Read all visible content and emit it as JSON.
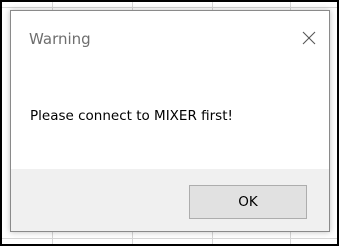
{
  "dialog": {
    "title": "Warning",
    "message": "Please connect to MIXER first!",
    "ok_label": "OK",
    "close_icon": "close-icon"
  },
  "colors": {
    "dialog_background": "#ffffff",
    "footer_background": "#f0f0f0",
    "button_background": "#e1e1e1",
    "button_border": "#adadad",
    "title_text": "#6e6e6e"
  }
}
